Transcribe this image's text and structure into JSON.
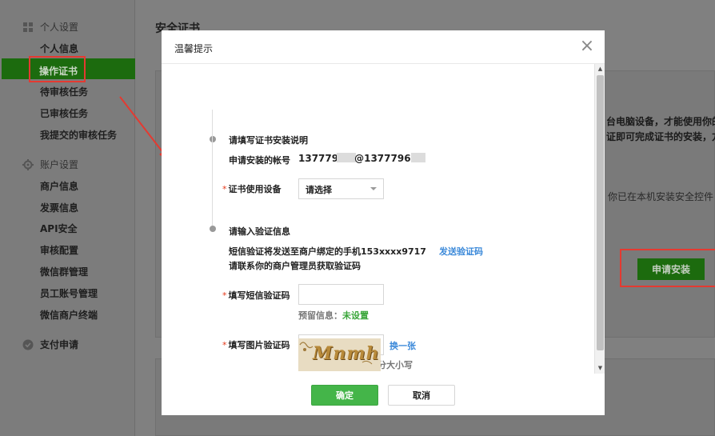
{
  "sidebar": {
    "groups": [
      {
        "label": "个人设置",
        "icon": "grid-icon",
        "items": [
          "个人信息",
          "操作证书",
          "待审核任务",
          "已审核任务",
          "我提交的审核任务"
        ]
      },
      {
        "label": "账户设置",
        "icon": "gear-icon",
        "items": [
          "商户信息",
          "发票信息",
          "API安全",
          "审核配置",
          "微信群管理",
          "员工账号管理",
          "微信商户终端"
        ]
      },
      {
        "label": "支付申请",
        "icon": "check-circle-icon",
        "items": []
      }
    ],
    "active_item": "操作证书"
  },
  "main": {
    "title": "安全证书",
    "desc_line1": "台电脑设备，才能使用你的",
    "desc_line2": "证即可完成证书的安装，方",
    "installed_note": "你已在本机安装安全控件",
    "apply_button": "申请安装"
  },
  "modal": {
    "title": "温馨提示",
    "close_icon": "×",
    "section1_title": "请填写证书安装说明",
    "account_label": "申请安装的帐号",
    "account_value_a": "137779",
    "account_value_b": "@1377796",
    "device_label": "证书使用设备",
    "device_select": "请选择",
    "section2_title": "请输入验证信息",
    "sms_info": "短信验证将发送至商户绑定的手机153xxxx9717",
    "send_code": "发送验证码",
    "contact_admin": "请联系你的商户管理员获取验证码",
    "sms_code_label": "填写短信验证码",
    "reserved_label": "预留信息：",
    "reserved_value": "未设置",
    "image_code_label": "填写图片验证码",
    "image_hint": "输入以下字符，不区分大小写",
    "captcha_text": "Mnmh",
    "refresh": "换一张",
    "required_mark": "*",
    "ok_button": "确定",
    "cancel_button": "取消"
  },
  "colors": {
    "accent_green": "#44b549",
    "link_blue": "#3b89d9",
    "annotation_red": "#e43a31"
  }
}
